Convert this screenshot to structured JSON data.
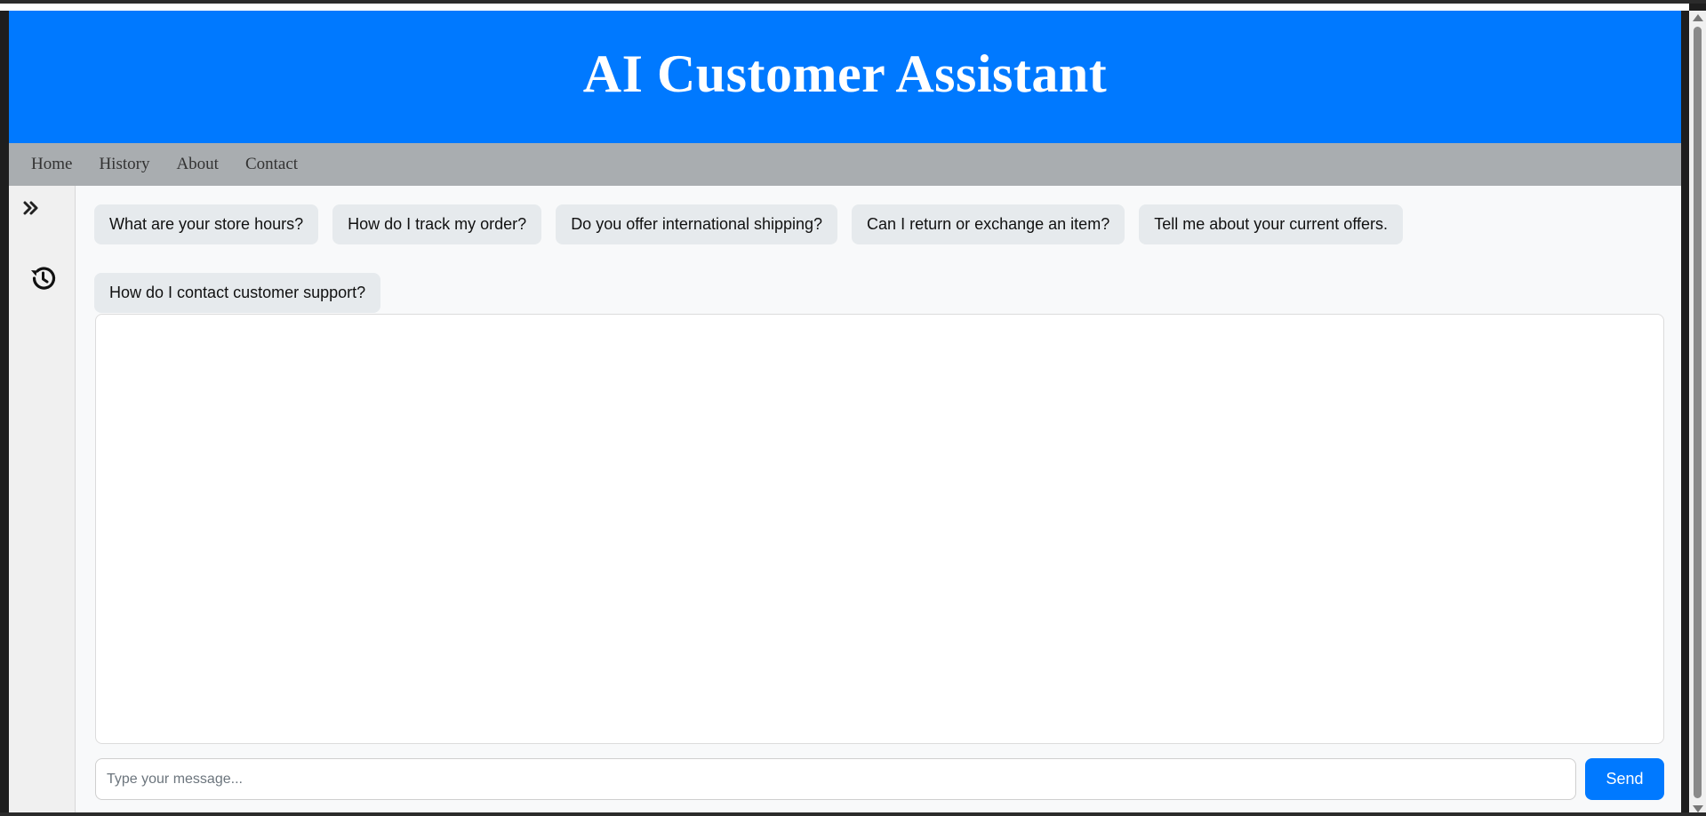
{
  "header": {
    "title": "AI Customer Assistant"
  },
  "nav": {
    "items": [
      "Home",
      "History",
      "About",
      "Contact"
    ]
  },
  "sidebar": {
    "expand_icon": "double-chevron-right-icon",
    "history_icon": "history-icon"
  },
  "suggestions": [
    "What are your store hours?",
    "How do I track my order?",
    "Do you offer international shipping?",
    "Can I return or exchange an item?",
    "Tell me about your current offers.",
    "How do I contact customer support?"
  ],
  "composer": {
    "placeholder": "Type your message...",
    "value": "",
    "send_label": "Send"
  },
  "colors": {
    "primary": "#0079ff",
    "nav_bg": "#a9adb0",
    "chip_bg": "#e6eaed"
  }
}
